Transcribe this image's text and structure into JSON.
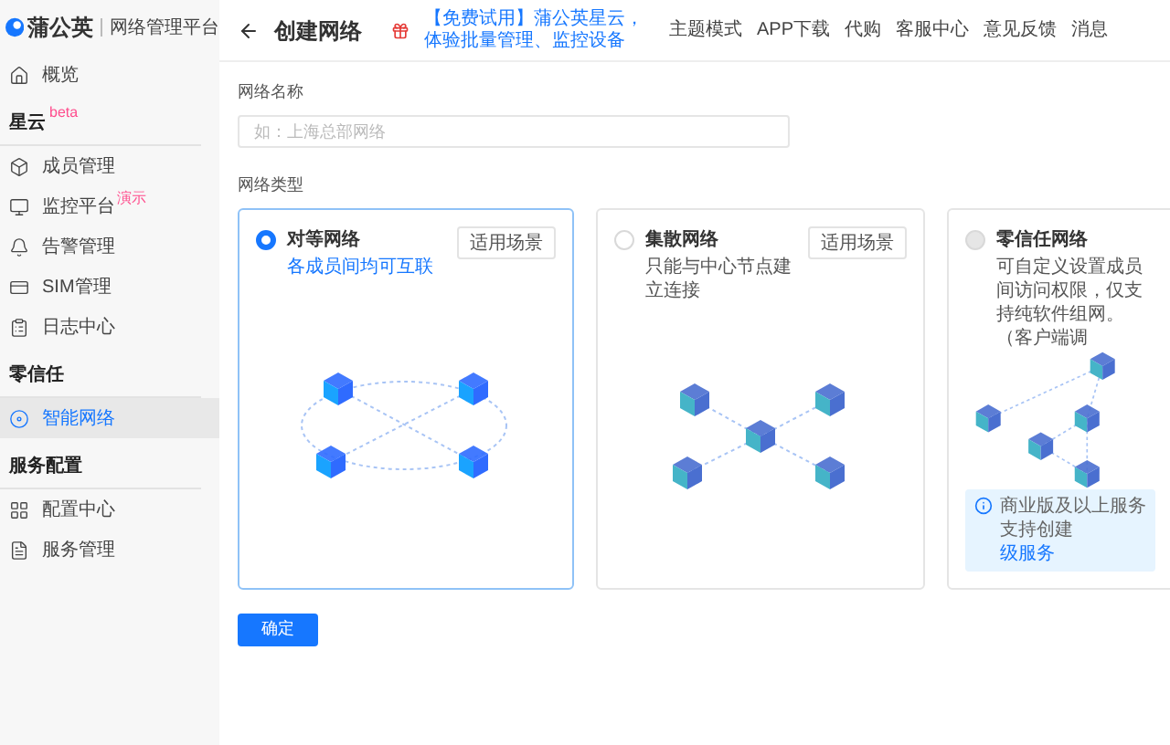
{
  "sidebar": {
    "logo": "蒲公英",
    "subtitle": "网络管理平台",
    "sections": [
      {
        "items": [
          {
            "label": "概览",
            "selected": false
          }
        ]
      },
      {
        "heading": "星云",
        "badge": "beta",
        "items": [
          {
            "label": "成员管理",
            "selected": false
          },
          {
            "label": "监控平台",
            "badge": "演示",
            "selected": false
          },
          {
            "label": "告警管理",
            "selected": false
          },
          {
            "label": "SIM管理",
            "selected": false
          },
          {
            "label": "日志中心",
            "selected": false
          }
        ]
      },
      {
        "heading": "零信任",
        "items": [
          {
            "label": "智能网络",
            "selected": true
          }
        ]
      },
      {
        "heading": "服务配置",
        "items": [
          {
            "label": "配置中心",
            "selected": false
          },
          {
            "label": "服务管理",
            "selected": false
          }
        ]
      }
    ]
  },
  "header": {
    "title": "创建网络",
    "promo": "【免费试用】蒲公英星云，体验批量管理、监控设备",
    "links": [
      "主题模式",
      "APP下载",
      "代购",
      "客服中心",
      "意见反馈",
      "消息"
    ]
  },
  "form": {
    "name_field": {
      "label": "网络名称",
      "placeholder": "如：上海总部网络"
    },
    "type_label": "网络类型",
    "cards": [
      {
        "kind": "peer",
        "title": "对等网络",
        "description": "各成员间均可互联",
        "button": "适用场景",
        "selected": true,
        "disabled": false
      },
      {
        "kind": "hub",
        "title": "集散网络",
        "description": "只能与中心节点建立连接",
        "button": "适用场景",
        "selected": false,
        "disabled": false
      },
      {
        "kind": "mesh",
        "title": "零信任网络",
        "description": "可自定义设置成员间访问权限，仅支持纯软件组网。（客户端调",
        "selected": false,
        "disabled": true,
        "notice": {
          "text": "商业版及以上服务支持创建",
          "link": "级服务"
        }
      }
    ],
    "submit": "确定"
  }
}
